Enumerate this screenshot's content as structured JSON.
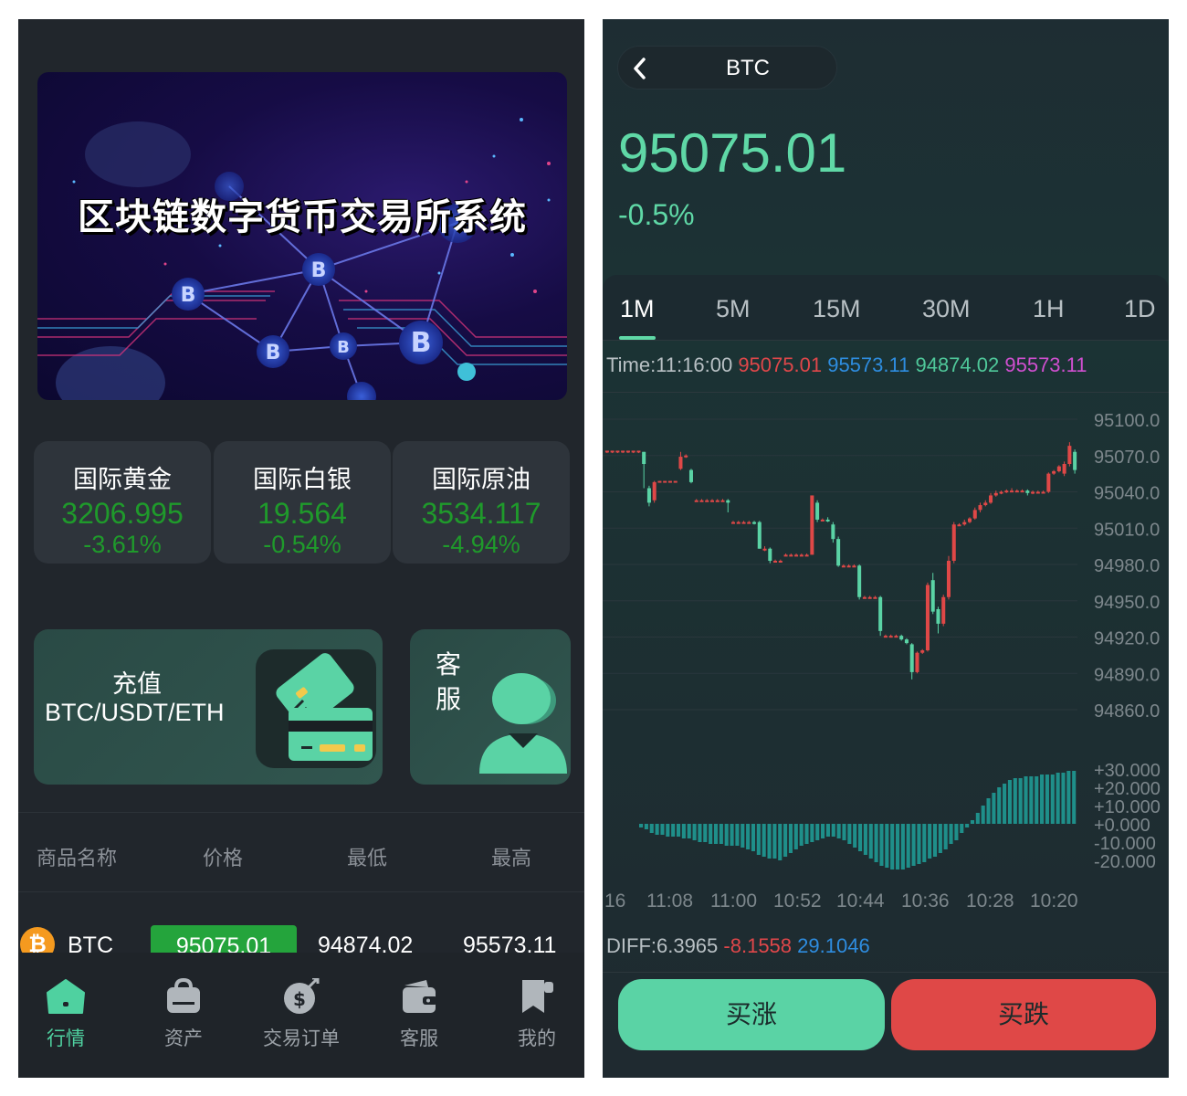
{
  "left_screen": {
    "banner": {
      "title": "区块链数字货币交易所系统"
    },
    "markets": [
      {
        "name": "国际黄金",
        "price": "3206.995",
        "change": "-3.61%"
      },
      {
        "name": "国际白银",
        "price": "19.564",
        "change": "-0.54%"
      },
      {
        "name": "国际原油",
        "price": "3534.117",
        "change": "-4.94%"
      }
    ],
    "recharge": {
      "title": "充值",
      "subtitle": "BTC/USDT/ETH"
    },
    "service": {
      "label": "客服"
    },
    "list_header": {
      "name": "商品名称",
      "price": "价格",
      "low": "最低",
      "high": "最高"
    },
    "list_rows": [
      {
        "symbol": "BTC",
        "price": "95075.01",
        "low": "94874.02",
        "high": "95573.11"
      }
    ],
    "tabbar": [
      {
        "label": "行情",
        "icon": "home-icon",
        "active": true
      },
      {
        "label": "资产",
        "icon": "bag-icon",
        "active": false
      },
      {
        "label": "交易订单",
        "icon": "money-bag-icon",
        "active": false
      },
      {
        "label": "客服",
        "icon": "wallet-icon",
        "active": false
      },
      {
        "label": "我的",
        "icon": "bookmark-icon",
        "active": false
      }
    ],
    "colors": {
      "background": "#21262c",
      "up_green": "#1f9a2b",
      "accent": "#4fd1a0"
    }
  },
  "right_screen": {
    "pair": "BTC",
    "price": "95075.01",
    "change": "-0.5%",
    "periods": [
      "1M",
      "5M",
      "15M",
      "30M",
      "1H",
      "1D"
    ],
    "active_period": "1M",
    "ohlc": {
      "prefix": "Time:11:16:00",
      "open": "95075.01",
      "high": "95573.11",
      "low": "94874.02",
      "close": "95573.11"
    },
    "diff": {
      "prefix": "DIFF:6.3965",
      "dea": "-8.1558",
      "macd": "29.1046"
    },
    "buttons": {
      "buy_up": "买涨",
      "buy_down": "买跌"
    },
    "colors": {
      "up": "#5ad3a5",
      "down": "#df4847",
      "open_text": "#e0474a",
      "high_text": "#2e8de0",
      "low_text": "#4fc89a",
      "close_text": "#d04fd0"
    }
  },
  "chart_data": [
    {
      "type": "candlestick",
      "title": "",
      "ylim": [
        94860,
        95100
      ],
      "y_ticks": [
        "95100.0",
        "95070.0",
        "95040.0",
        "95010.0",
        "94980.0",
        "94950.0",
        "94920.0",
        "94890.0",
        "94860.0"
      ],
      "x_ticks": [
        "16",
        "11:08",
        "11:00",
        "10:52",
        "10:44",
        "10:36",
        "10:28",
        "10:20"
      ],
      "candles": [
        [
          95070,
          95071,
          95069,
          95070
        ],
        [
          95070,
          95071,
          95069,
          95070
        ],
        [
          95070,
          95071,
          95069,
          95070
        ],
        [
          95070,
          95071,
          95069,
          95070
        ],
        [
          95070,
          95071,
          95069,
          95070
        ],
        [
          95070,
          95071,
          95069,
          95070
        ],
        [
          95070,
          95071,
          95069,
          95070
        ],
        [
          95070,
          95060,
          95070,
          95040
        ],
        [
          95040,
          95028,
          95042,
          95025
        ],
        [
          95030,
          95045,
          95046,
          95028
        ],
        [
          95045,
          95046,
          95046,
          95045
        ],
        [
          95046,
          95046,
          95046,
          95046
        ],
        [
          95046,
          95046,
          95046,
          95046
        ],
        [
          95046,
          95046,
          95046,
          95046
        ],
        [
          95056,
          95066,
          95070,
          95055
        ],
        [
          95066,
          95067,
          95068,
          95065
        ],
        [
          95055,
          95045,
          95056,
          95044
        ],
        [
          95030,
          95030,
          95031,
          95029
        ],
        [
          95030,
          95030,
          95031,
          95029
        ],
        [
          95030,
          95030,
          95031,
          95029
        ],
        [
          95030,
          95030,
          95031,
          95029
        ],
        [
          95030,
          95030,
          95031,
          95029
        ],
        [
          95030,
          95030,
          95031,
          95029
        ],
        [
          95030,
          95028,
          95031,
          95020
        ],
        [
          95012,
          95012,
          95013,
          95011
        ],
        [
          95012,
          95012,
          95013,
          95011
        ],
        [
          95012,
          95012,
          95013,
          95011
        ],
        [
          95012,
          95012,
          95013,
          95011
        ],
        [
          95012,
          95011,
          95013,
          95010
        ],
        [
          95012,
          94990,
          95013,
          94990
        ],
        [
          94990,
          94990,
          94992,
          94988
        ],
        [
          94990,
          94980,
          94991,
          94978
        ],
        [
          94980,
          94980,
          94981,
          94979
        ],
        [
          94980,
          94980,
          94981,
          94979
        ],
        [
          94985,
          94985,
          94986,
          94984
        ],
        [
          94985,
          94985,
          94986,
          94984
        ],
        [
          94985,
          94985,
          94986,
          94984
        ],
        [
          94985,
          94985,
          94986,
          94984
        ],
        [
          94985,
          94985,
          94986,
          94984
        ],
        [
          94985,
          95034,
          95034,
          94985
        ],
        [
          95028,
          95014,
          95030,
          95012
        ],
        [
          95014,
          95014,
          95015,
          95013
        ],
        [
          95014,
          95013,
          95016,
          95012
        ],
        [
          95010,
          94998,
          95012,
          94995
        ],
        [
          94998,
          94976,
          95000,
          94975
        ],
        [
          94976,
          94976,
          94977,
          94975
        ],
        [
          94976,
          94976,
          94977,
          94975
        ],
        [
          94976,
          94976,
          94977,
          94975
        ],
        [
          94976,
          94950,
          94977,
          94948
        ],
        [
          94950,
          94950,
          94951,
          94949
        ],
        [
          94950,
          94950,
          94951,
          94949
        ],
        [
          94950,
          94950,
          94951,
          94949
        ],
        [
          94950,
          94922,
          94951,
          94918
        ],
        [
          94918,
          94918,
          94919,
          94917
        ],
        [
          94918,
          94918,
          94919,
          94917
        ],
        [
          94918,
          94918,
          94919,
          94917
        ],
        [
          94918,
          94915,
          94919,
          94914
        ],
        [
          94915,
          94912,
          94916,
          94911
        ],
        [
          94911,
          94888,
          94912,
          94882
        ],
        [
          94888,
          94904,
          94905,
          94887
        ],
        [
          94904,
          94906,
          94907,
          94903
        ],
        [
          94906,
          94960,
          94962,
          94905
        ],
        [
          94964,
          94938,
          94970,
          94936
        ],
        [
          94940,
          94928,
          94942,
          94920
        ],
        [
          94928,
          94950,
          94952,
          94926
        ],
        [
          94950,
          94980,
          94984,
          94948
        ],
        [
          94980,
          95010,
          95012,
          94978
        ],
        [
          95010,
          95010,
          95011,
          95009
        ],
        [
          95010,
          95012,
          95014,
          95009
        ],
        [
          95012,
          95015,
          95016,
          95011
        ],
        [
          95015,
          95022,
          95024,
          95014
        ],
        [
          95022,
          95026,
          95028,
          95020
        ],
        [
          95026,
          95028,
          95030,
          95025
        ],
        [
          95028,
          95034,
          95036,
          95027
        ],
        [
          95034,
          95036,
          95038,
          95033
        ],
        [
          95036,
          95037,
          95038,
          95035
        ],
        [
          95037,
          95038,
          95039,
          95036
        ],
        [
          95038,
          95038,
          95040,
          95037
        ],
        [
          95038,
          95038,
          95039,
          95037
        ],
        [
          95038,
          95038,
          95039,
          95037
        ],
        [
          95038,
          95036,
          95039,
          95034
        ],
        [
          95036,
          95037,
          95038,
          95035
        ],
        [
          95037,
          95037,
          95038,
          95036
        ],
        [
          95037,
          95037,
          95038,
          95036
        ],
        [
          95037,
          95052,
          95053,
          95036
        ],
        [
          95052,
          95054,
          95055,
          95051
        ],
        [
          95054,
          95058,
          95059,
          95053
        ],
        [
          95052,
          95060,
          95062,
          95050
        ],
        [
          95060,
          95075,
          95078,
          95058
        ],
        [
          95070,
          95055,
          95072,
          95052
        ]
      ]
    },
    {
      "type": "bar",
      "title": "",
      "ylim": [
        -20,
        30
      ],
      "y_ticks": [
        "+30.000",
        "+20.000",
        "+10.000",
        "+0.000",
        "-10.000",
        "-20.000"
      ],
      "values": [
        -2,
        -3,
        -5,
        -6,
        -6,
        -7,
        -7,
        -7,
        -8,
        -8,
        -9,
        -10,
        -10,
        -11,
        -11,
        -11,
        -12,
        -12,
        -12,
        -13,
        -14,
        -15,
        -17,
        -18,
        -19,
        -19,
        -20,
        -18,
        -16,
        -14,
        -12,
        -11,
        -10,
        -9,
        -8,
        -7,
        -7,
        -8,
        -9,
        -11,
        -13,
        -15,
        -17,
        -19,
        -21,
        -23,
        -24,
        -25,
        -25,
        -25,
        -24,
        -23,
        -22,
        -21,
        -19,
        -18,
        -16,
        -14,
        -11,
        -9,
        -5,
        -2,
        2,
        6,
        10,
        14,
        17,
        20,
        22,
        24,
        25,
        25,
        26,
        26,
        26,
        27,
        27,
        27,
        28,
        28,
        29,
        29
      ]
    }
  ]
}
